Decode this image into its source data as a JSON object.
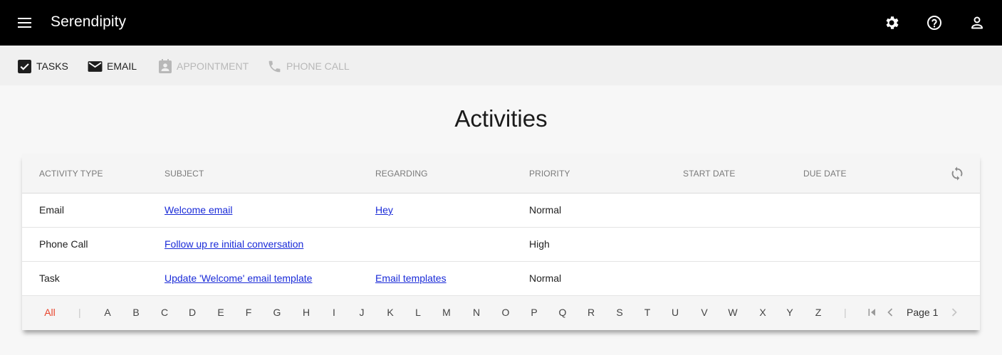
{
  "app": {
    "title": "Serendipity"
  },
  "topbar_icons": [
    "menu-icon",
    "gear-icon",
    "help-icon",
    "user-icon"
  ],
  "commands": [
    {
      "label": "TASKS",
      "icon": "checkbox-icon",
      "enabled": true
    },
    {
      "label": "EMAIL",
      "icon": "envelope-icon",
      "enabled": true
    },
    {
      "label": "APPOINTMENT",
      "icon": "contact-card-icon",
      "enabled": false
    },
    {
      "label": "PHONE CALL",
      "icon": "phone-icon",
      "enabled": false
    }
  ],
  "page": {
    "title": "Activities"
  },
  "grid": {
    "columns": [
      "ACTIVITY TYPE",
      "SUBJECT",
      "REGARDING",
      "PRIORITY",
      "START DATE",
      "DUE DATE"
    ],
    "rows": [
      {
        "type": "Email",
        "subject": "Welcome email",
        "regarding": "Hey",
        "priority": "Normal",
        "start_date": "",
        "due_date": ""
      },
      {
        "type": "Phone Call",
        "subject": "Follow up re initial conversation",
        "regarding": "",
        "priority": "High",
        "start_date": "",
        "due_date": ""
      },
      {
        "type": "Task",
        "subject": "Update 'Welcome' email template",
        "regarding": "Email templates",
        "priority": "Normal",
        "start_date": "",
        "due_date": ""
      }
    ]
  },
  "alphabet": {
    "all": "All",
    "separator": "|",
    "letters": [
      "A",
      "B",
      "C",
      "D",
      "E",
      "F",
      "G",
      "H",
      "I",
      "J",
      "K",
      "L",
      "M",
      "N",
      "O",
      "P",
      "Q",
      "R",
      "S",
      "T",
      "U",
      "V",
      "W",
      "X",
      "Y",
      "Z"
    ]
  },
  "pager": {
    "page_label": "Page 1"
  },
  "colors": {
    "topbar": "#000000",
    "link": "#1a2bd8",
    "all_active": "#e8432b",
    "disabled": "#b8b8b8"
  }
}
